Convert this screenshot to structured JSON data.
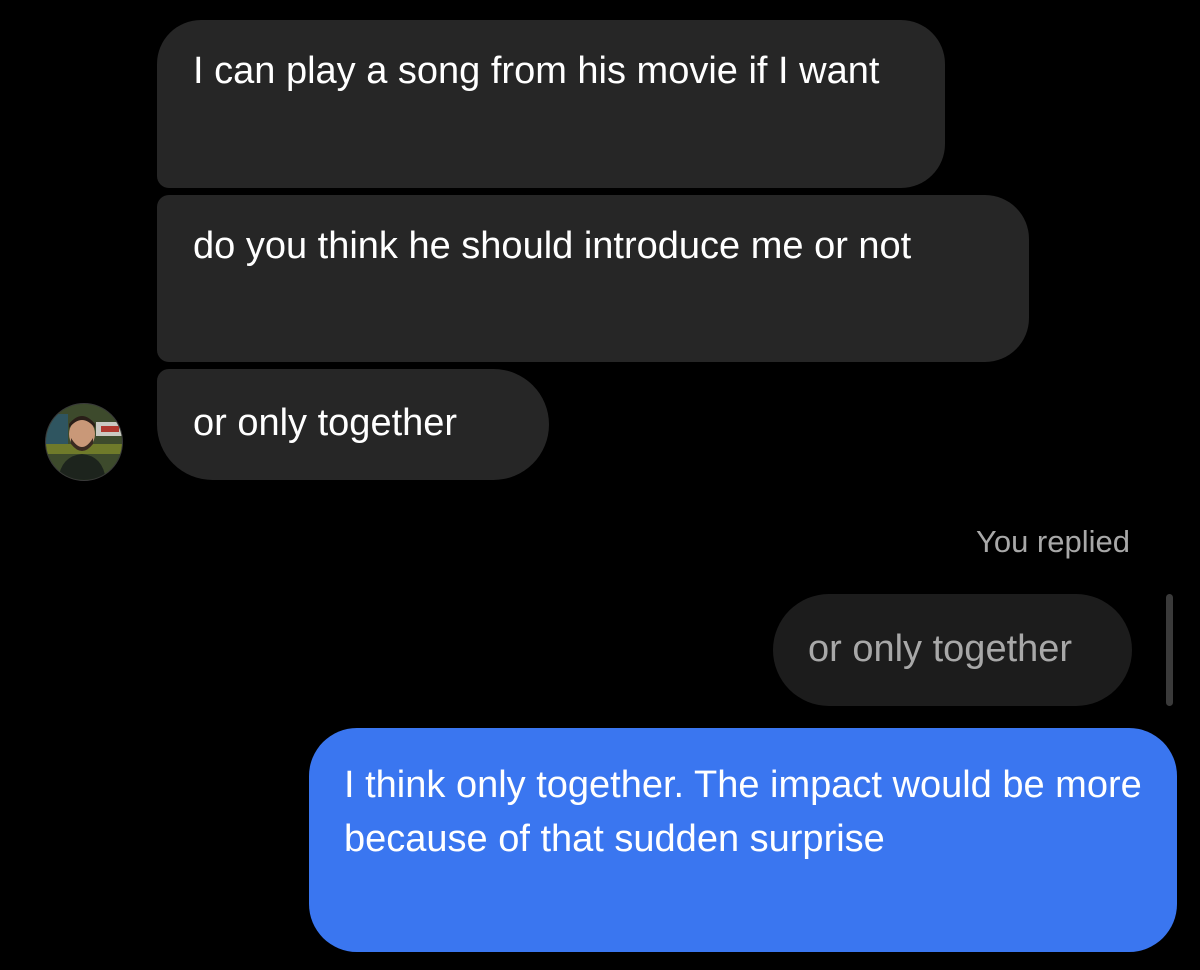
{
  "messages": {
    "incoming": [
      {
        "text": "I can play a song from his movie if I want"
      },
      {
        "text": "do you think he should introduce me or not"
      },
      {
        "text": "or only together"
      }
    ],
    "reply_label": "You replied",
    "quoted_text": "or only together",
    "outgoing": {
      "text": "I think only together. The impact would be more because of that sudden surprise"
    }
  },
  "colors": {
    "background": "#000000",
    "incoming_bubble": "#262626",
    "quoted_bubble": "#1c1c1c",
    "outgoing_bubble": "#3a76f0",
    "muted_text": "#a8a8a8"
  },
  "icons": {
    "avatar": "user-avatar"
  }
}
